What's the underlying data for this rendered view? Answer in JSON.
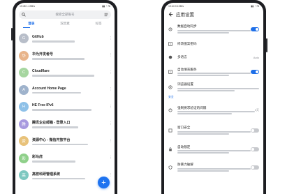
{
  "left_phone": {
    "status_time": "19:45 1.1KB/s",
    "status_icons": "▮▮ ◔ 78",
    "search_placeholder": "搜索全部账号",
    "tabs": [
      {
        "label": "登录",
        "active": true
      },
      {
        "label": "双因素",
        "active": false
      },
      {
        "label": "标签",
        "active": false
      }
    ],
    "accounts": [
      {
        "initial": "G",
        "title": "GitHub",
        "color": "#b8bec9"
      },
      {
        "initial": "华",
        "title": "华为开发者号",
        "color": "#e8b48a"
      },
      {
        "initial": "C",
        "title": "Cloudflare",
        "color": "#a6d6a0"
      },
      {
        "initial": "A",
        "title": "Account Home Page",
        "color": "#9fb3cc"
      },
      {
        "initial": "H",
        "title": "HE Free IPv6",
        "color": "#8ec1e8"
      },
      {
        "initial": "腾",
        "title": "腾讯企业邮箱 - 登录入口",
        "color": "#a89adf"
      },
      {
        "initial": "资",
        "title": "资源中心 - 微信开放平台",
        "color": "#e8c27a"
      },
      {
        "initial": "彩",
        "title": "彩马虎",
        "color": "#8fd08a"
      },
      {
        "initial": "高",
        "title": "高校科研管理系统",
        "color": "#7ec8c0"
      }
    ],
    "fab_label": "+"
  },
  "right_phone": {
    "status_time": "19:44 0.1KB/s",
    "status_icons": "▮▮ ◔ 78",
    "title": "应用设置",
    "rows_top": [
      {
        "title": "数据自动同步",
        "has_sub": true,
        "control": "on"
      },
      {
        "title": "修改图案密码",
        "has_sub": false,
        "control": ""
      },
      {
        "title": "多语言",
        "has_sub": false,
        "control": "value",
        "value": "Auto"
      },
      {
        "title": "自动填充服务",
        "has_sub": true,
        "control": "on"
      },
      {
        "title": "浏览器设置",
        "has_sub": true,
        "control": ""
      }
    ],
    "section": "安全",
    "rows_bottom": [
      {
        "title": "强制要求验证的间隔",
        "has_sub": true,
        "control": "value",
        "value": "3天"
      },
      {
        "title": "窗口安全",
        "has_sub": true,
        "control": "off"
      },
      {
        "title": "自动锁定",
        "has_sub": true,
        "control": "off"
      },
      {
        "title": "防暴力破解",
        "has_sub": true,
        "control": "off"
      }
    ]
  },
  "colors": {
    "accent": "#1e6fe8",
    "frame": "#1d1e22"
  },
  "icons": {
    "search": "search-icon",
    "menu": "menu-icon",
    "back": "back-arrow-icon",
    "more": "more-vertical-icon"
  }
}
